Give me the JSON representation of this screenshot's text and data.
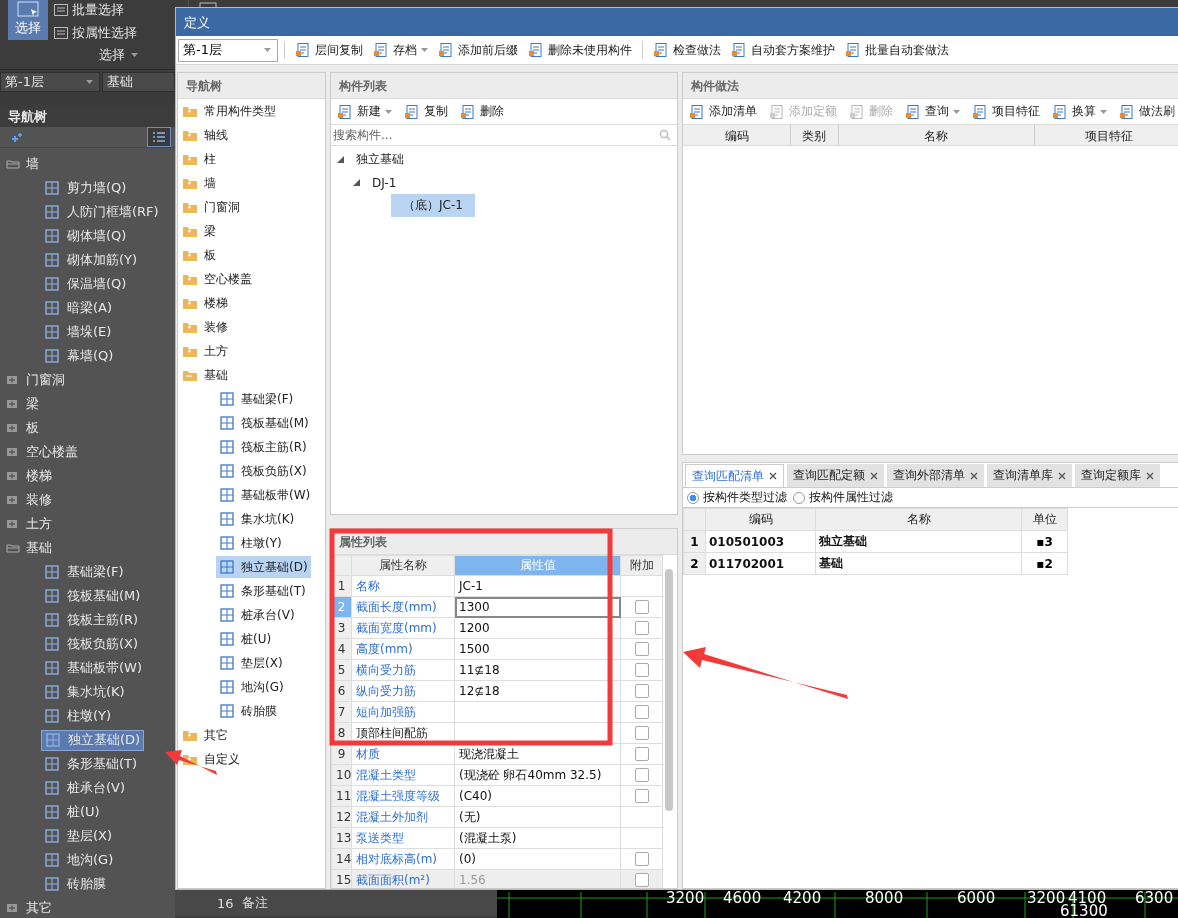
{
  "app": {
    "ribbon": {
      "select_button": {
        "label": "选择",
        "selected": true
      },
      "items": [
        "批量选择",
        "按属性选择"
      ],
      "group_label": "选择"
    },
    "floor_select": "第-1层",
    "category_select": "基础",
    "nav_title": "导航树",
    "tree": [
      {
        "label": "墙",
        "expanded": true,
        "selected": false,
        "children": [
          {
            "label": "剪力墙(Q)",
            "selected": false
          },
          {
            "label": "人防门框墙(RF)",
            "selected": false
          },
          {
            "label": "砌体墙(Q)",
            "selected": false
          },
          {
            "label": "砌体加筋(Y)",
            "selected": false
          },
          {
            "label": "保温墙(Q)",
            "selected": false
          },
          {
            "label": "暗梁(A)",
            "selected": false
          },
          {
            "label": "墙垛(E)",
            "selected": false
          },
          {
            "label": "幕墙(Q)",
            "selected": false
          }
        ]
      },
      {
        "label": "门窗洞",
        "expanded": false,
        "selected": false
      },
      {
        "label": "梁",
        "expanded": false,
        "selected": false
      },
      {
        "label": "板",
        "expanded": false,
        "selected": false
      },
      {
        "label": "空心楼盖",
        "expanded": false,
        "selected": false
      },
      {
        "label": "楼梯",
        "expanded": false,
        "selected": false
      },
      {
        "label": "装修",
        "expanded": false,
        "selected": false
      },
      {
        "label": "土方",
        "expanded": false,
        "selected": false
      },
      {
        "label": "基础",
        "expanded": true,
        "selected": false,
        "children": [
          {
            "label": "基础梁(F)",
            "selected": false
          },
          {
            "label": "筏板基础(M)",
            "selected": false
          },
          {
            "label": "筏板主筋(R)",
            "selected": false
          },
          {
            "label": "筏板负筋(X)",
            "selected": false
          },
          {
            "label": "基础板带(W)",
            "selected": false
          },
          {
            "label": "集水坑(K)",
            "selected": false
          },
          {
            "label": "柱墩(Y)",
            "selected": false
          },
          {
            "label": "独立基础(D)",
            "selected": true
          },
          {
            "label": "条形基础(T)",
            "selected": false
          },
          {
            "label": "桩承台(V)",
            "selected": false
          },
          {
            "label": "桩(U)",
            "selected": false
          },
          {
            "label": "垫层(X)",
            "selected": false
          },
          {
            "label": "地沟(G)",
            "selected": false
          },
          {
            "label": "砖胎膜",
            "selected": false
          }
        ]
      },
      {
        "label": "其它",
        "expanded": false,
        "selected": false
      }
    ],
    "bg_property_row": {
      "index": "16",
      "name": "备注"
    },
    "cad_dimensions": [
      "3200",
      "4600",
      "4200",
      "8000",
      "6000",
      "3200",
      "4100",
      "6300"
    ],
    "cad_total": "61300"
  },
  "dialog": {
    "title": "定义",
    "floor_select": "第-1层",
    "toolbar": [
      {
        "label": "层间复制",
        "dropdown": false
      },
      {
        "label": "存档",
        "dropdown": true
      },
      {
        "label": "添加前后缀",
        "dropdown": false
      },
      {
        "label": "删除未使用构件",
        "dropdown": false
      },
      {
        "label": "检查做法",
        "dropdown": false
      },
      {
        "label": "自动套方案维护",
        "dropdown": false
      },
      {
        "label": "批量自动套做法",
        "dropdown": false
      }
    ],
    "nav_tree": {
      "title": "导航树",
      "items": [
        {
          "label": "常用构件类型",
          "expanded": false,
          "selected": false
        },
        {
          "label": "轴线",
          "expanded": false,
          "selected": false
        },
        {
          "label": "柱",
          "expanded": false,
          "selected": false
        },
        {
          "label": "墙",
          "expanded": false,
          "selected": false
        },
        {
          "label": "门窗洞",
          "expanded": false,
          "selected": false
        },
        {
          "label": "梁",
          "expanded": false,
          "selected": false
        },
        {
          "label": "板",
          "expanded": false,
          "selected": false
        },
        {
          "label": "空心楼盖",
          "expanded": false,
          "selected": false
        },
        {
          "label": "楼梯",
          "expanded": false,
          "selected": false
        },
        {
          "label": "装修",
          "expanded": false,
          "selected": false
        },
        {
          "label": "土方",
          "expanded": false,
          "selected": false
        },
        {
          "label": "基础",
          "expanded": true,
          "selected": false,
          "children": [
            {
              "label": "基础梁(F)",
              "selected": false
            },
            {
              "label": "筏板基础(M)",
              "selected": false
            },
            {
              "label": "筏板主筋(R)",
              "selected": false
            },
            {
              "label": "筏板负筋(X)",
              "selected": false
            },
            {
              "label": "基础板带(W)",
              "selected": false
            },
            {
              "label": "集水坑(K)",
              "selected": false
            },
            {
              "label": "柱墩(Y)",
              "selected": false
            },
            {
              "label": "独立基础(D)",
              "selected": true
            },
            {
              "label": "条形基础(T)",
              "selected": false
            },
            {
              "label": "桩承台(V)",
              "selected": false
            },
            {
              "label": "桩(U)",
              "selected": false
            },
            {
              "label": "垫层(X)",
              "selected": false
            },
            {
              "label": "地沟(G)",
              "selected": false
            },
            {
              "label": "砖胎膜",
              "selected": false
            }
          ]
        },
        {
          "label": "其它",
          "expanded": false,
          "selected": false
        },
        {
          "label": "自定义",
          "expanded": false,
          "selected": false
        }
      ]
    },
    "component_list": {
      "title": "构件列表",
      "toolbar": [
        {
          "label": "新建",
          "dropdown": true
        },
        {
          "label": "复制",
          "dropdown": false
        },
        {
          "label": "删除",
          "dropdown": false
        }
      ],
      "search": {
        "placeholder": "搜索构件..."
      },
      "tree": [
        {
          "label": "独立基础",
          "expanded": true,
          "selected": false,
          "children": [
            {
              "label": "DJ-1",
              "expanded": true,
              "selected": false,
              "children": [
                {
                  "label": "（底）JC-1",
                  "selected": true
                }
              ]
            }
          ]
        }
      ]
    },
    "property_list": {
      "title": "属性列表",
      "columns": [
        "属性名称",
        "属性值",
        "附加"
      ],
      "rows": [
        {
          "index": "1",
          "name": "名称",
          "value": "JC-1",
          "public": true,
          "attachable": false,
          "selected": false,
          "disabled": false
        },
        {
          "index": "2",
          "name": "截面长度(mm)",
          "value": "1300",
          "public": true,
          "attachable": true,
          "checked": false,
          "selected": true,
          "disabled": false
        },
        {
          "index": "3",
          "name": "截面宽度(mm)",
          "value": "1200",
          "public": true,
          "attachable": true,
          "checked": false,
          "selected": false,
          "disabled": false
        },
        {
          "index": "4",
          "name": "高度(mm)",
          "value": "1500",
          "public": true,
          "attachable": true,
          "checked": false,
          "selected": false,
          "disabled": false
        },
        {
          "index": "5",
          "name": "横向受力筋",
          "value": "11⊈18",
          "public": true,
          "attachable": true,
          "checked": false,
          "selected": false,
          "disabled": false
        },
        {
          "index": "6",
          "name": "纵向受力筋",
          "value": "12⊈18",
          "public": true,
          "attachable": true,
          "checked": false,
          "selected": false,
          "disabled": false
        },
        {
          "index": "7",
          "name": "短向加强筋",
          "value": "",
          "public": true,
          "attachable": true,
          "checked": false,
          "selected": false,
          "disabled": false
        },
        {
          "index": "8",
          "name": "顶部柱间配筋",
          "value": "",
          "public": false,
          "attachable": true,
          "checked": false,
          "selected": false,
          "disabled": false
        },
        {
          "index": "9",
          "name": "材质",
          "value": "现浇混凝土",
          "public": true,
          "attachable": true,
          "checked": false,
          "selected": false,
          "disabled": false
        },
        {
          "index": "10",
          "name": "混凝土类型",
          "value": "(现浇砼 卵石40mm 32.5)",
          "public": true,
          "attachable": true,
          "checked": false,
          "selected": false,
          "disabled": false
        },
        {
          "index": "11",
          "name": "混凝土强度等级",
          "value": "(C40)",
          "public": true,
          "attachable": true,
          "checked": false,
          "selected": false,
          "disabled": false
        },
        {
          "index": "12",
          "name": "混凝土外加剂",
          "value": "(无)",
          "public": true,
          "attachable": false,
          "selected": false,
          "disabled": false
        },
        {
          "index": "13",
          "name": "泵送类型",
          "value": "(混凝土泵)",
          "public": true,
          "attachable": false,
          "selected": false,
          "disabled": false
        },
        {
          "index": "14",
          "name": "相对底标高(m)",
          "value": "(0)",
          "public": true,
          "attachable": true,
          "checked": false,
          "selected": false,
          "disabled": false
        },
        {
          "index": "15",
          "name": "截面面积(m²)",
          "value": "1.56",
          "public": true,
          "attachable": true,
          "checked": false,
          "selected": false,
          "disabled": true
        }
      ]
    },
    "methods": {
      "title": "构件做法",
      "toolbar": [
        {
          "label": "添加清单",
          "disabled": false,
          "dropdown": false
        },
        {
          "label": "添加定额",
          "disabled": true,
          "dropdown": false
        },
        {
          "label": "删除",
          "disabled": true,
          "dropdown": false
        },
        {
          "label": "查询",
          "disabled": false,
          "dropdown": true
        },
        {
          "label": "项目特征",
          "disabled": false,
          "dropdown": false
        },
        {
          "label": "换算",
          "disabled": false,
          "dropdown": true
        },
        {
          "label": "做法刷",
          "disabled": false,
          "dropdown": false
        }
      ],
      "columns": [
        "编码",
        "类别",
        "名称",
        "项目特征"
      ]
    },
    "query": {
      "tabs": [
        {
          "label": "查询匹配清单",
          "selected": true
        },
        {
          "label": "查询匹配定额",
          "selected": false
        },
        {
          "label": "查询外部清单",
          "selected": false
        },
        {
          "label": "查询清单库",
          "selected": false
        },
        {
          "label": "查询定额库",
          "selected": false
        }
      ],
      "filters": [
        {
          "label": "按构件类型过滤",
          "selected": true
        },
        {
          "label": "按构件属性过滤",
          "selected": false
        }
      ],
      "columns": [
        "编码",
        "名称",
        "单位"
      ],
      "rows": [
        {
          "index": "1",
          "code": "010501003",
          "name": "独立基础",
          "unit": "▪3"
        },
        {
          "index": "2",
          "code": "011702001",
          "name": "基础",
          "unit": "▪2"
        }
      ]
    }
  }
}
